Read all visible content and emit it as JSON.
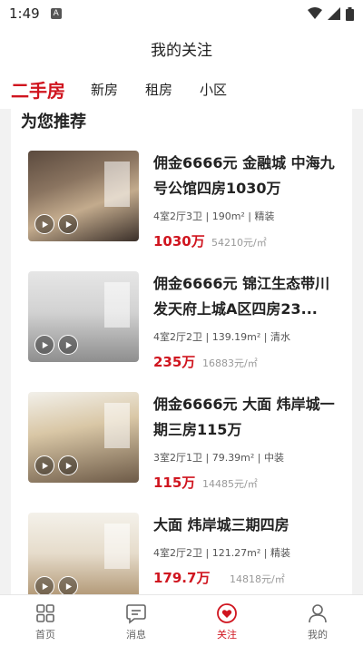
{
  "status_bar": {
    "time": "1:49",
    "notification_icon": "A"
  },
  "header": {
    "title": "我的关注"
  },
  "tabs": [
    {
      "label": "二手房",
      "active": true
    },
    {
      "label": "新房",
      "active": false
    },
    {
      "label": "租房",
      "active": false
    },
    {
      "label": "小区",
      "active": false
    }
  ],
  "section": {
    "title": "为您推荐"
  },
  "listings": [
    {
      "title": "佣金6666元 金融城 中海九号公馆四房1030万",
      "meta": "4室2厅3卫 | 190m² | 精装",
      "price": "1030万",
      "unit_price": "54210元/㎡"
    },
    {
      "title": "佣金6666元 锦江生态带川发天府上城A区四房23...",
      "meta": "4室2厅2卫 | 139.19m² | 清水",
      "price": "235万",
      "unit_price": "16883元/㎡"
    },
    {
      "title": "佣金6666元 大面 炜岸城一期三房115万",
      "meta": "3室2厅1卫 | 79.39m² | 中装",
      "price": "115万",
      "unit_price": "14485元/㎡"
    },
    {
      "title": "大面 炜岸城三期四房",
      "meta": "4室2厅2卫 | 121.27m² | 精装",
      "price": "179.7万",
      "unit_price": "14818元/㎡"
    }
  ],
  "bottom_nav": [
    {
      "label": "首页",
      "icon": "grid-icon",
      "active": false
    },
    {
      "label": "消息",
      "icon": "message-icon",
      "active": false
    },
    {
      "label": "关注",
      "icon": "heart-icon",
      "active": true
    },
    {
      "label": "我的",
      "icon": "user-icon",
      "active": false
    }
  ],
  "colors": {
    "accent": "#d0151f",
    "background": "#f2f2f2"
  }
}
